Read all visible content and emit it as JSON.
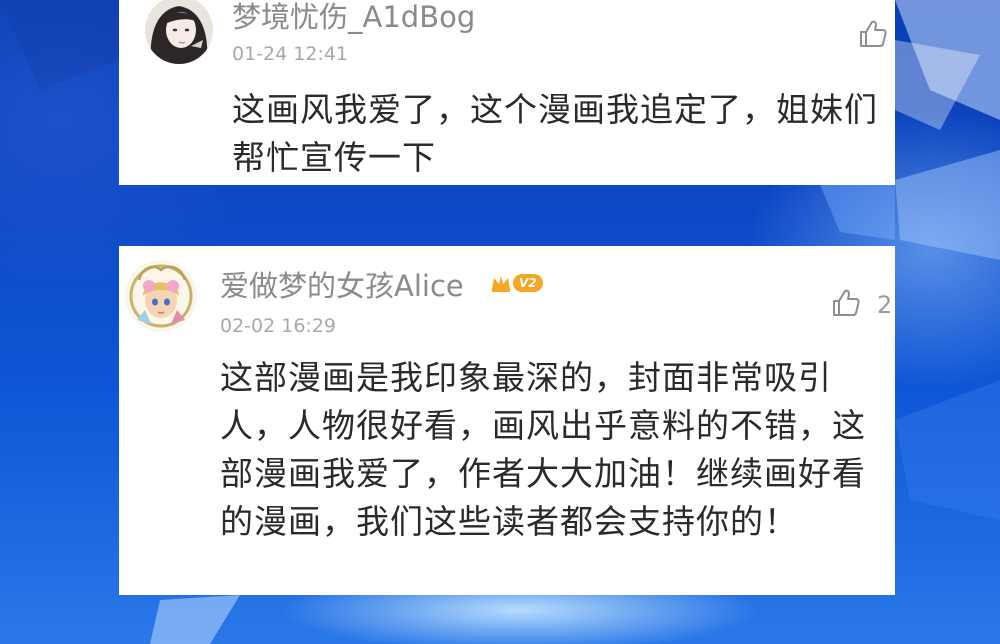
{
  "comments": [
    {
      "username": "梦境忧伤_A1dBog",
      "time": "01-24 12:41",
      "text": "这画风我爱了，这个漫画我追定了，姐妹们帮忙宣传一下",
      "like_count": ""
    },
    {
      "username": "爱做梦的女孩Alice",
      "badge": "V2",
      "time": "02-02 16:29",
      "text": "这部漫画是我印象最深的，封面非常吸引人，人物很好看，画风出乎意料的不错，这部漫画我爱了，作者大大加油！继续画好看的漫画，我们这些读者都会支持你的！",
      "like_count": "2"
    }
  ],
  "icons": {
    "like": "thumbs-up-icon",
    "badge": "crown-icon"
  },
  "colors": {
    "background": "#0e56d6",
    "card": "#ffffff",
    "username": "#8a8a8a",
    "badge": "#f5a623"
  }
}
